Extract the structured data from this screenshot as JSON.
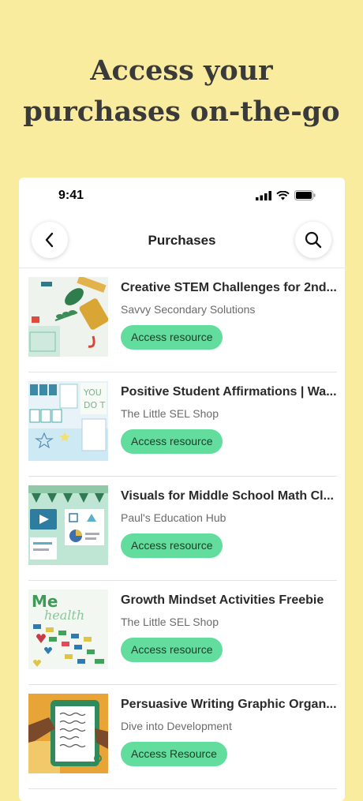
{
  "headline": {
    "line1": "Access your",
    "line2": "purchases on-the-go"
  },
  "status_bar": {
    "time": "9:41"
  },
  "nav": {
    "title": "Purchases",
    "back_icon": "chevron-left-icon",
    "search_icon": "search-icon"
  },
  "items": [
    {
      "title": "Creative STEM Challenges for 2nd...",
      "author": "Savvy Secondary Solutions",
      "button": "Access resource"
    },
    {
      "title": "Positive Student Affirmations | Wa...",
      "author": "The Little SEL Shop",
      "button": "Access resource"
    },
    {
      "title": "Visuals for Middle School Math Cl...",
      "author": "Paul's Education Hub",
      "button": "Access resource"
    },
    {
      "title": "Growth Mindset Activities Freebie",
      "author": "The Little SEL Shop",
      "button": "Access resource"
    },
    {
      "title": "Persuasive Writing Graphic Organ...",
      "author": "Dive into Development",
      "button": "Access Resource"
    }
  ],
  "colors": {
    "background": "#f9ec9f",
    "button": "#62dd9d"
  }
}
